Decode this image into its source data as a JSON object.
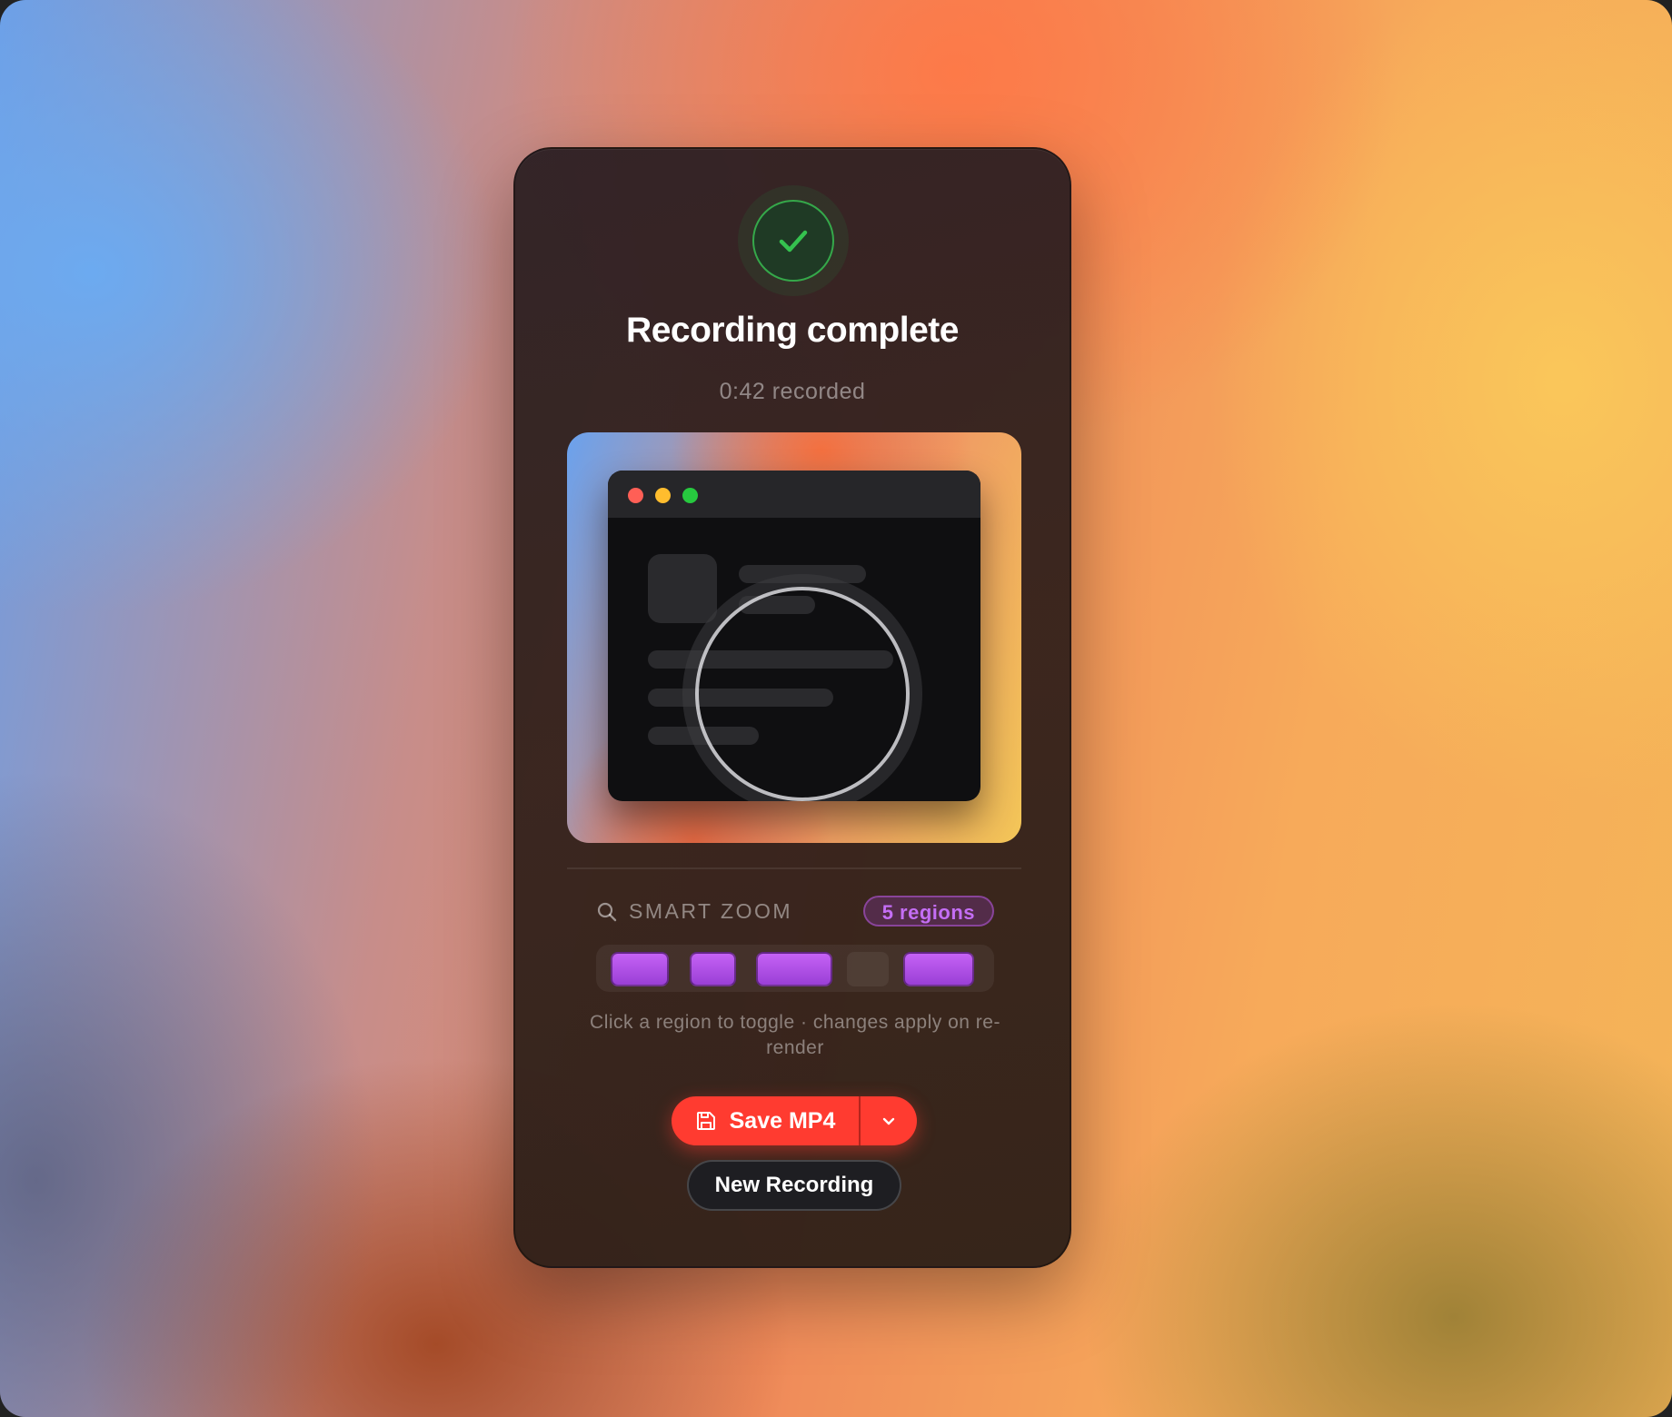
{
  "dialog": {
    "title": "Recording complete",
    "subtitle": "0:42 recorded"
  },
  "status": {
    "icon": "checkmark-icon",
    "color": "#35c24f"
  },
  "preview": {
    "window_controls": [
      "close",
      "minimize",
      "maximize"
    ],
    "control_colors": [
      "#ff5f56",
      "#ffbd2e",
      "#27c93f"
    ],
    "zoom_lens_icon": "magnifier-lens"
  },
  "smart_zoom": {
    "label": "SMART ZOOM",
    "icon": "search-icon",
    "badge": "5 regions",
    "accent_color": "#c562f5",
    "regions": [
      {
        "enabled": true
      },
      {
        "enabled": true
      },
      {
        "enabled": true
      },
      {
        "enabled": false
      },
      {
        "enabled": true
      }
    ],
    "hint": "Click a region to toggle · changes apply on re-render"
  },
  "actions": {
    "save_label": "Save MP4",
    "save_icon": "save-icon",
    "save_color": "#ff3b30",
    "menu_icon": "chevron-down-icon",
    "new_recording_label": "New Recording"
  }
}
